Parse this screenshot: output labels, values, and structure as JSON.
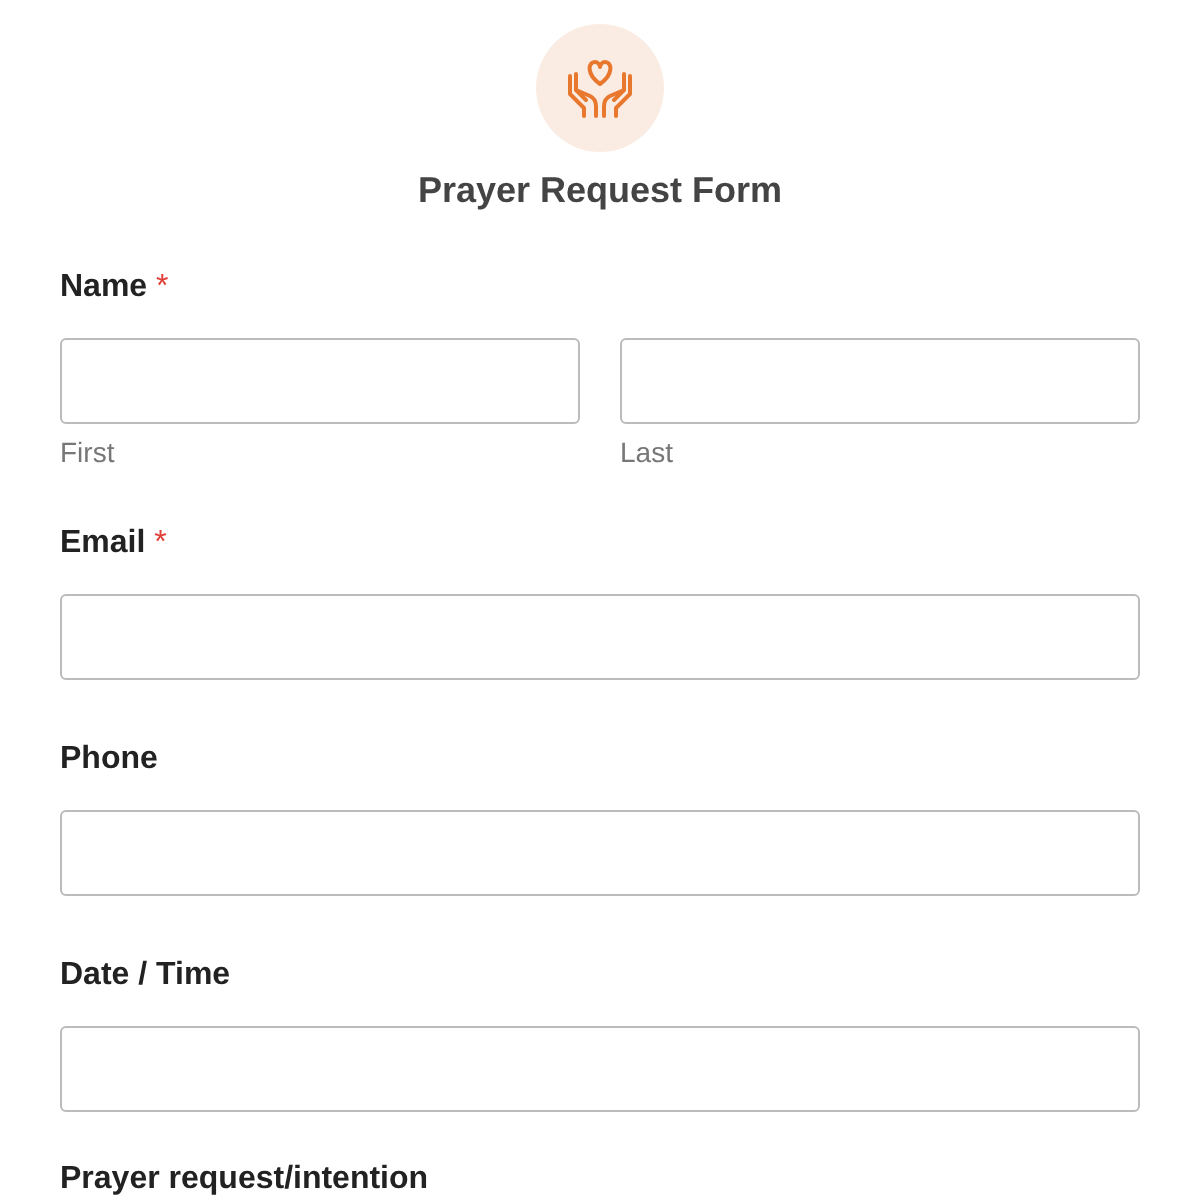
{
  "form": {
    "title": "Prayer Request Form"
  },
  "fields": [
    {
      "kind": "split",
      "label": "Name",
      "required_mark": "*",
      "parts": [
        {
          "sublabel": "First"
        },
        {
          "sublabel": "Last"
        }
      ]
    },
    {
      "kind": "single",
      "label": "Email",
      "required_mark": "*"
    },
    {
      "kind": "single",
      "label": "Phone"
    },
    {
      "kind": "single",
      "label": "Date / Time"
    },
    {
      "kind": "heading",
      "label": "Prayer request/intention"
    }
  ]
}
